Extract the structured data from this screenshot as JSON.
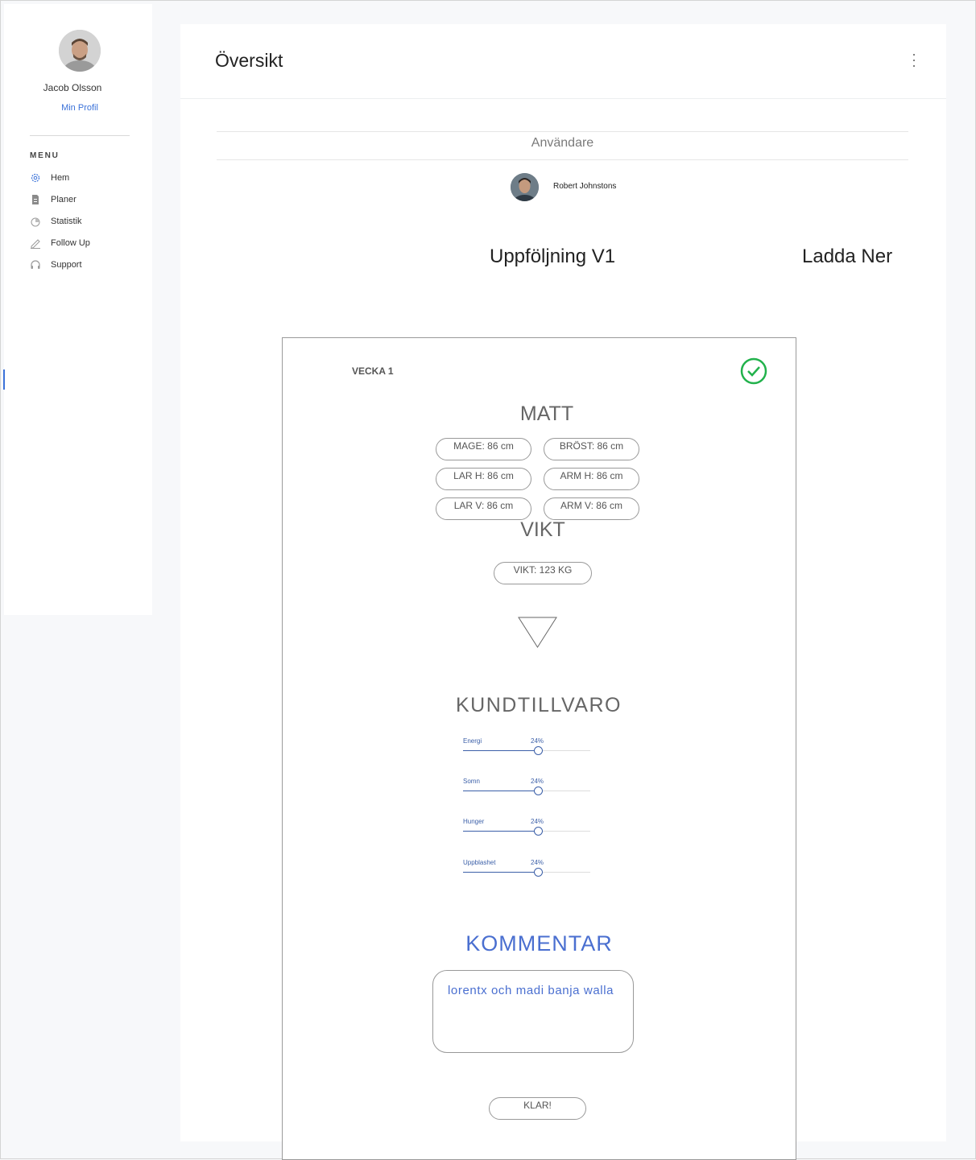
{
  "sidebar": {
    "user_name": "Jacob Olsson",
    "profile_link": "Min Profil",
    "menu_title": "MENU",
    "items": [
      {
        "label": "Hem",
        "icon": "gear-icon"
      },
      {
        "label": "Planer",
        "icon": "document-icon"
      },
      {
        "label": "Statistik",
        "icon": "pie-chart-icon"
      },
      {
        "label": "Follow Up",
        "icon": "pencil-icon"
      },
      {
        "label": "Support",
        "icon": "headset-icon"
      }
    ],
    "active_color": "#3b72d9"
  },
  "header": {
    "title": "Översikt"
  },
  "client": {
    "section_label": "Användare",
    "name": "Robert Johnstons"
  },
  "plan": {
    "title": "Uppföljning V1",
    "download_label": "Ladda Ner"
  },
  "card": {
    "week_label": "VECKA 1",
    "measure_heading": "MATT",
    "measurements": {
      "mage": "MAGE: 86 cm",
      "brost": "BRÖST: 86 cm",
      "lar_h": "LAR H: 86 cm",
      "arm_h": "ARM H: 86 cm",
      "lar_v": "LAR V: 86 cm",
      "arm_v": "ARM V: 86 cm"
    },
    "weight_heading": "VIKT",
    "weight_value": "VIKT: 123 KG",
    "wellbeing_heading": "KUNDTILLVARO",
    "sliders": [
      {
        "label": "Energi",
        "value": "24%",
        "level": 0.59
      },
      {
        "label": "Somn",
        "value": "24%",
        "level": 0.59
      },
      {
        "label": "Hunger",
        "value": "24%",
        "level": 0.59
      },
      {
        "label": "Uppblashet",
        "value": "24%",
        "level": 0.59
      }
    ],
    "comment_heading": "KOMMENTAR",
    "comment_text": "lorentx och madi banja walla",
    "done_label": "KLAR!",
    "accent_color": "#4a6fd0",
    "check_color": "#22b24c"
  }
}
